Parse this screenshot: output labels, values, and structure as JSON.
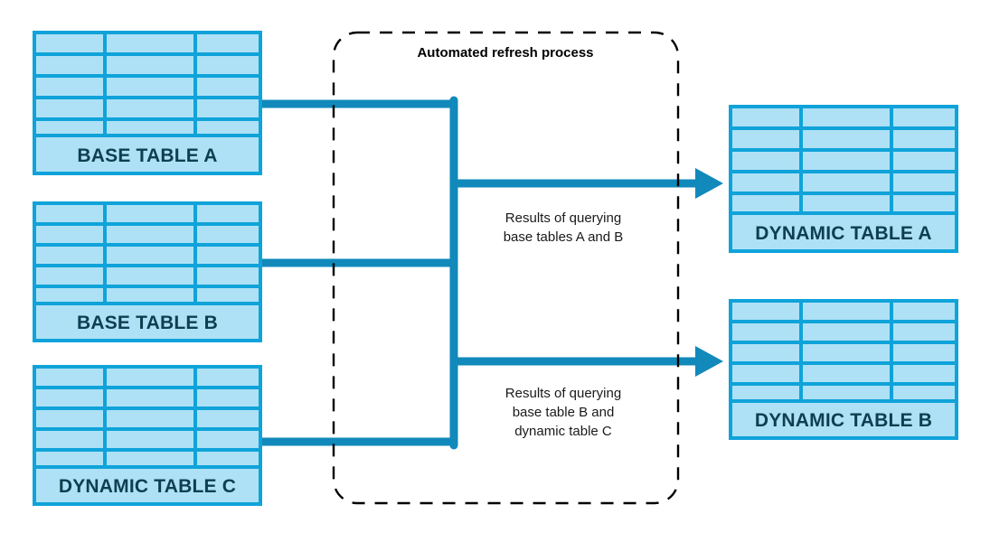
{
  "diagram": {
    "title": "Automated refresh process",
    "colors": {
      "table_fill": "#aee1f5",
      "table_border": "#0fa3da",
      "table_label_text": "#0d3f50",
      "connector": "#1189bb",
      "process_border": "#000000",
      "background": "#ffffff"
    },
    "process_box": {
      "label": "Automated refresh process",
      "style": "dashed-rounded"
    },
    "source_tables": [
      {
        "id": "base-table-a",
        "label": "BASE TABLE A",
        "rows": 5,
        "columns": 3
      },
      {
        "id": "base-table-b",
        "label": "BASE TABLE B",
        "rows": 5,
        "columns": 3
      },
      {
        "id": "dynamic-table-c",
        "label": "DYNAMIC TABLE C",
        "rows": 5,
        "columns": 3
      }
    ],
    "target_tables": [
      {
        "id": "dynamic-table-a",
        "label": "DYNAMIC TABLE A",
        "rows": 5,
        "columns": 3
      },
      {
        "id": "dynamic-table-b",
        "label": "DYNAMIC TABLE B",
        "rows": 5,
        "columns": 3
      }
    ],
    "edge_labels": [
      {
        "id": "edge-label-top",
        "lines": [
          "Results of querying",
          "base tables A and B"
        ],
        "line1": "Results of querying",
        "line2": "base tables A and B",
        "line3": ""
      },
      {
        "id": "edge-label-bottom",
        "lines": [
          "Results of querying",
          "base table B and",
          "dynamic table C"
        ],
        "line1": "Results of querying",
        "line2": "base table B and",
        "line3": "dynamic table C"
      }
    ],
    "flows": [
      {
        "id": "flow-to-dynamic-a",
        "sources": [
          "BASE TABLE A",
          "BASE TABLE B"
        ],
        "target": "DYNAMIC TABLE A"
      },
      {
        "id": "flow-to-dynamic-b",
        "sources": [
          "BASE TABLE B",
          "DYNAMIC TABLE C"
        ],
        "target": "DYNAMIC TABLE B"
      }
    ]
  }
}
